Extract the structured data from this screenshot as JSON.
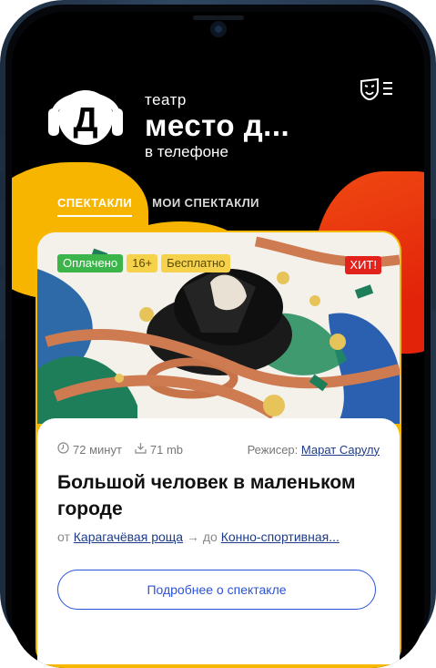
{
  "app": {
    "title_top": "театр",
    "title_main": "место д...",
    "title_sub": "в телефоне",
    "logo_letter": "Д"
  },
  "icons": {
    "menu": "masks-menu-icon",
    "duration": "clock-icon",
    "size": "download-icon"
  },
  "tabs": [
    {
      "label": "СПЕКТАКЛИ",
      "active": true
    },
    {
      "label": "МОИ СПЕКТАКЛИ",
      "active": false
    }
  ],
  "card": {
    "badges": {
      "paid": "Оплачено",
      "age": "16+",
      "free": "Бесплатно",
      "hit": "ХИТ!"
    },
    "duration": "72 минут",
    "size": "71 mb",
    "director_label": "Режисер:",
    "director_name": "Марат Сарулу",
    "title": "Большой человек в маленьком городе",
    "route_from_label": "от",
    "route_from": "Карагачёвая роща",
    "route_arrow": "→",
    "route_to_label": "до",
    "route_to": "Конно-спортивная...",
    "more_button": "Подробнее о спектакле"
  },
  "colors": {
    "accent_yellow": "#f7b500",
    "accent_red": "#e2230a",
    "link_blue": "#1d3b8a",
    "button_blue": "#2b52d9",
    "badge_green": "#3bb54a",
    "badge_red": "#e3231b"
  }
}
